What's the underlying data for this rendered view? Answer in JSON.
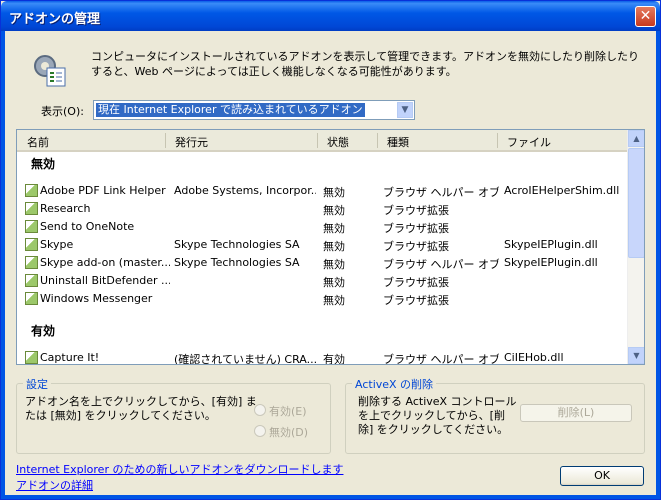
{
  "window": {
    "title": "アドオンの管理",
    "close_glyph": "✕"
  },
  "description": "コンピュータにインストールされているアドオンを表示して管理できます。アドオンを無効にしたり削除したりすると、Web ページによっては正しく機能しなくなる可能性があります。",
  "show": {
    "label": "表示(O):",
    "selected": "現在 Internet Explorer で読み込まれているアドオン"
  },
  "columns": [
    "名前",
    "発行元",
    "状態",
    "種類",
    "ファイル"
  ],
  "groups": [
    {
      "label": "無効",
      "rows": [
        {
          "name": "Adobe PDF Link Helper",
          "publisher": "Adobe Systems, Incorpor...",
          "status": "無効",
          "type": "ブラウザ ヘルパー オブ...",
          "file": "AcroIEHelperShim.dll"
        },
        {
          "name": "Research",
          "publisher": "",
          "status": "無効",
          "type": "ブラウザ拡張",
          "file": ""
        },
        {
          "name": "Send to OneNote",
          "publisher": "",
          "status": "無効",
          "type": "ブラウザ拡張",
          "file": ""
        },
        {
          "name": "Skype",
          "publisher": "Skype Technologies SA",
          "status": "無効",
          "type": "ブラウザ拡張",
          "file": "SkypeIEPlugin.dll"
        },
        {
          "name": "Skype add-on (master...",
          "publisher": "Skype Technologies SA",
          "status": "無効",
          "type": "ブラウザ ヘルパー オブ...",
          "file": "SkypeIEPlugin.dll"
        },
        {
          "name": "Uninstall BitDefender ...",
          "publisher": "",
          "status": "無効",
          "type": "ブラウザ拡張",
          "file": ""
        },
        {
          "name": "Windows Messenger",
          "publisher": "",
          "status": "無効",
          "type": "ブラウザ拡張",
          "file": ""
        }
      ]
    },
    {
      "label": "有効",
      "rows": [
        {
          "name": "Capture It!",
          "publisher": "(確認されていません) CRA...",
          "status": "有効",
          "type": "ブラウザ ヘルパー オブ...",
          "file": "CiIEHob.dll"
        }
      ]
    }
  ],
  "settings": {
    "title": "設定",
    "text": "アドオン名を上でクリックしてから、[有効] または [無効] をクリックしてください。",
    "enable": "有効(E)",
    "disable": "無効(D)"
  },
  "activex": {
    "title": "ActiveX の削除",
    "text": "削除する ActiveX コントロールを上でクリックしてから、[削除] をクリックしてください。",
    "delete": "削除(L)"
  },
  "links": {
    "download": "Internet Explorer のための新しいアドオンをダウンロードします",
    "details": "アドオンの詳細"
  },
  "ok": "OK"
}
